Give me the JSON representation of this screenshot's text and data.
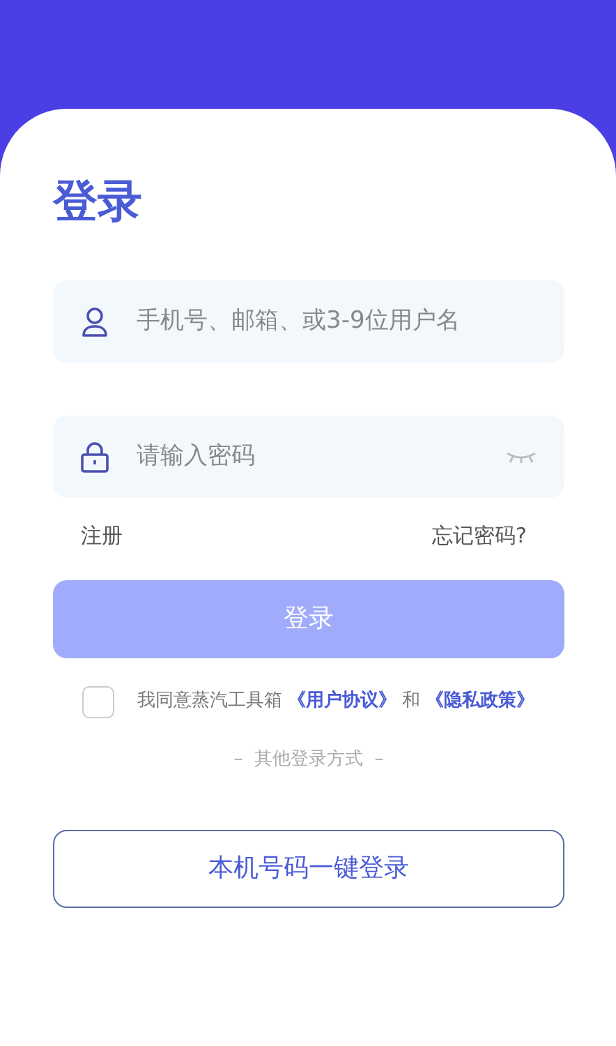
{
  "title": "登录",
  "username_field": {
    "placeholder": "手机号、邮箱、或3-9位用户名"
  },
  "password_field": {
    "placeholder": "请输入密码",
    "password_visible": false
  },
  "links": [
    {
      "label": "注册"
    },
    {
      "label": "忘记密码?"
    }
  ],
  "login_button": {
    "label": "登录",
    "disabled": true
  },
  "agreement": {
    "checked": false,
    "parts": [
      {
        "kind": "text",
        "text": "我同意蒸汽工具箱"
      },
      {
        "kind": "link",
        "text": "《用户协议》"
      },
      {
        "kind": "text",
        "text": "和"
      },
      {
        "kind": "link",
        "text": "《隐私政策》"
      }
    ]
  },
  "other_login_label": "–  其他登录方式  –",
  "one_click_button": {
    "label": "本机号码一键登录"
  }
}
